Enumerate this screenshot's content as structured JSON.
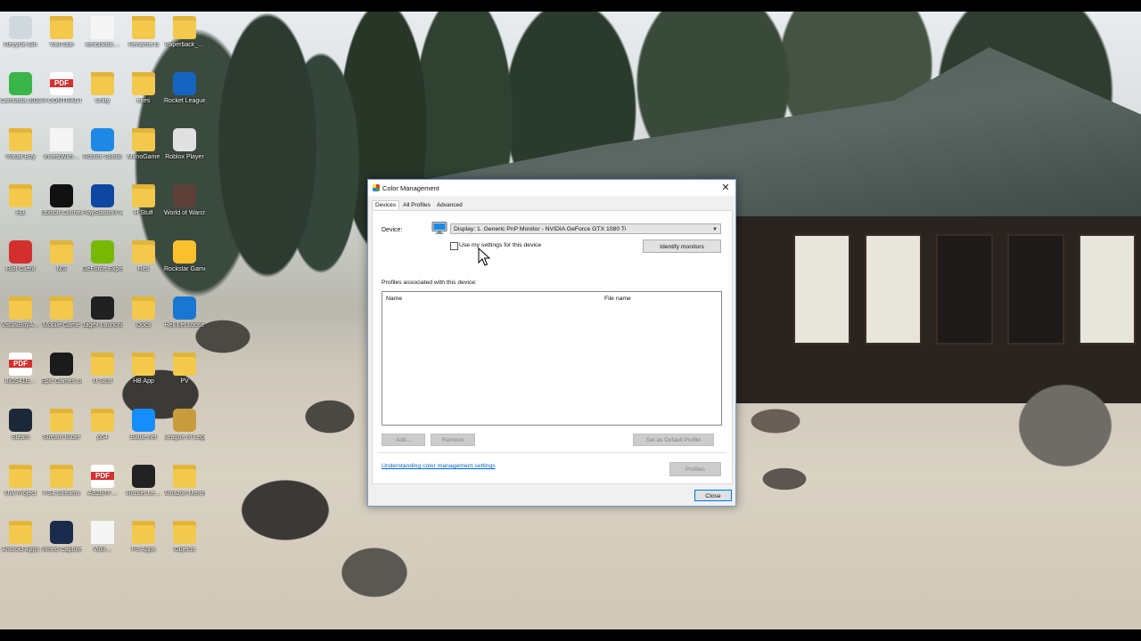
{
  "desktop": {
    "icons": [
      {
        "label": "Recycle Bin",
        "type": "app",
        "color": "#cfd8dc"
      },
      {
        "label": "YouTube",
        "type": "folder"
      },
      {
        "label": "xenobiotic…",
        "type": "file"
      },
      {
        "label": "Rename.lu",
        "type": "folder"
      },
      {
        "label": "Paperback_…",
        "type": "folder"
      },
      {
        "label": "Camtasia 2022",
        "type": "app",
        "color": "#3ab54a"
      },
      {
        "label": "III CONTRACT…",
        "type": "pdf"
      },
      {
        "label": "Unity",
        "type": "folder"
      },
      {
        "label": "exes",
        "type": "folder"
      },
      {
        "label": "Rocket League",
        "type": "app",
        "color": "#1565c0"
      },
      {
        "label": "Visual Boy",
        "type": "folder"
      },
      {
        "label": "InvestWith…",
        "type": "file"
      },
      {
        "label": "Roblox Studio",
        "type": "app",
        "color": "#1e88e5"
      },
      {
        "label": "MonoGame",
        "type": "folder"
      },
      {
        "label": "Roblox Player",
        "type": "app",
        "color": "#e0e0e0"
      },
      {
        "label": "HB",
        "type": "folder"
      },
      {
        "label": "Ubisoft Connect",
        "type": "app",
        "color": "#111111"
      },
      {
        "label": "PlayStation® Accessories",
        "type": "app",
        "color": "#0d47a1"
      },
      {
        "label": "H Stuff",
        "type": "folder"
      },
      {
        "label": "World of Warcraft",
        "type": "app",
        "color": "#5d4037"
      },
      {
        "label": "Riot Client",
        "type": "app",
        "color": "#d32f2f"
      },
      {
        "label": "MS",
        "type": "folder"
      },
      {
        "label": "GeForce Experience",
        "type": "app",
        "color": "#76b900"
      },
      {
        "label": "Res",
        "type": "folder"
      },
      {
        "label": "Rockstar Games …",
        "type": "app",
        "color": "#fbc02d"
      },
      {
        "label": "VisualBoyA…",
        "type": "folder"
      },
      {
        "label": "Mobile Game",
        "type": "folder"
      },
      {
        "label": "Jagex Launcher",
        "type": "app",
        "color": "#212121"
      },
      {
        "label": "Docs",
        "type": "folder"
      },
      {
        "label": "Hell Let Loose",
        "type": "app",
        "color": "#1976d2"
      },
      {
        "label": "8x2941E…",
        "type": "pdf"
      },
      {
        "label": "Epic Games Launcher",
        "type": "app",
        "color": "#1b1b1b"
      },
      {
        "label": "U Stuff",
        "type": "folder"
      },
      {
        "label": "HB App",
        "type": "folder"
      },
      {
        "label": "PV",
        "type": "folder"
      },
      {
        "label": "Steam",
        "type": "app",
        "color": "#1b2838"
      },
      {
        "label": "Stream folder",
        "type": "folder"
      },
      {
        "label": "p64",
        "type": "folder"
      },
      {
        "label": "Battle.net",
        "type": "app",
        "color": "#148eff"
      },
      {
        "label": "League of Legends",
        "type": "app",
        "color": "#c89b3c"
      },
      {
        "label": "UW Project",
        "type": "folder"
      },
      {
        "label": "PS4 Streams",
        "type": "folder"
      },
      {
        "label": "AB2B7F…",
        "type": "pdf"
      },
      {
        "label": "Rocket Le…",
        "type": "app",
        "color": "#222222"
      },
      {
        "label": "Amazon Merch",
        "type": "folder"
      },
      {
        "label": "Android Apps",
        "type": "folder"
      },
      {
        "label": "Vimeo Capture 1.0",
        "type": "app",
        "color": "#1a2b4c"
      },
      {
        "label": "Vido…",
        "type": "file"
      },
      {
        "label": "PS Apps",
        "type": "folder"
      },
      {
        "label": "Objects",
        "type": "folder"
      }
    ]
  },
  "dialog": {
    "title": "Color Management",
    "close_glyph": "✕",
    "tabs": [
      "Devices",
      "All Profiles",
      "Advanced"
    ],
    "device_label": "Device:",
    "device_value": "Display: 1. Generic PnP Monitor - NVIDIA GeForce GTX 1080 Ti",
    "use_my_settings": "Use my settings for this device",
    "identify_monitors": "Identify monitors",
    "profiles_label": "Profiles associated with this device:",
    "columns": {
      "name": "Name",
      "file": "File name"
    },
    "add": "Add...",
    "remove": "Remove",
    "set_default": "Set as Default Profile",
    "link": "Understanding color management settings",
    "profiles_button": "Profiles",
    "close": "Close"
  }
}
